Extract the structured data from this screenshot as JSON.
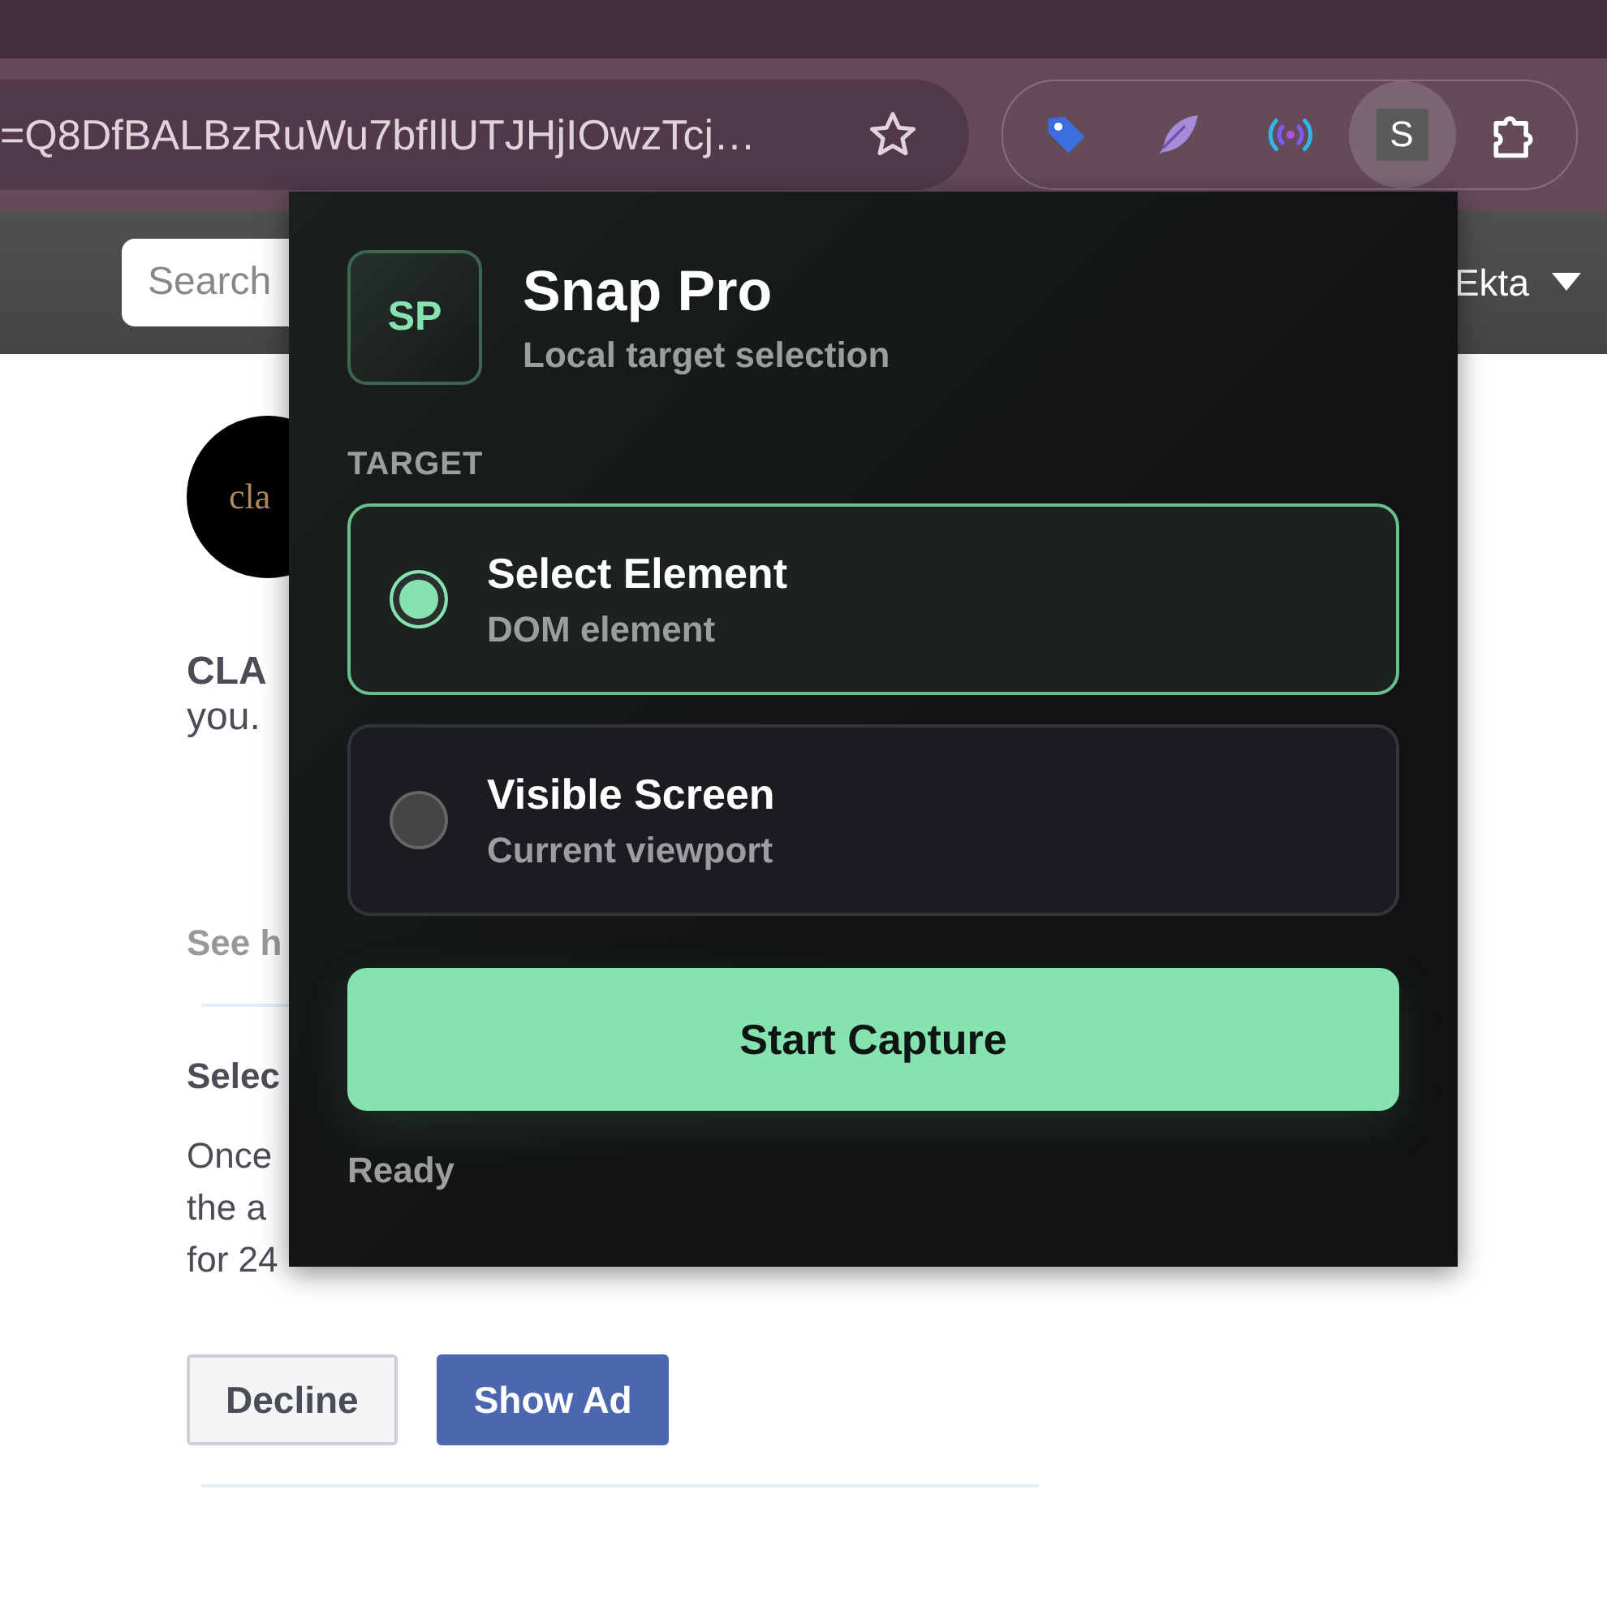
{
  "browser": {
    "address": "=Q8DfBALBzRuWu7bfIlUTJHjIOwzTcj…",
    "starred": false,
    "extensions": [
      {
        "kind": "tag"
      },
      {
        "kind": "feather"
      },
      {
        "kind": "broadcast"
      },
      {
        "kind": "letter",
        "label": "S",
        "active": true
      },
      {
        "kind": "puzzle"
      }
    ]
  },
  "site_header": {
    "search": {
      "placeholder": "Search"
    },
    "user": "Ekta"
  },
  "post": {
    "logo_text": "cla",
    "title": "CLA",
    "body": "you.",
    "link": "See h",
    "section_title": "Selec",
    "lines": [
      "Once",
      "the a",
      "for 24"
    ],
    "buttons": [
      {
        "label": "Decline",
        "kind": "secondary"
      },
      {
        "label": "Show Ad",
        "kind": "primary"
      }
    ]
  },
  "popup": {
    "logo": "SP",
    "title": "Snap Pro",
    "subtitle": "Local target selection",
    "section_label": "TARGET",
    "options": [
      {
        "title": "Select Element",
        "subtitle": "DOM element",
        "selected": true
      },
      {
        "title": "Visible Screen",
        "subtitle": "Current viewport",
        "selected": false
      }
    ],
    "action": "Start Capture",
    "status": "Ready"
  }
}
